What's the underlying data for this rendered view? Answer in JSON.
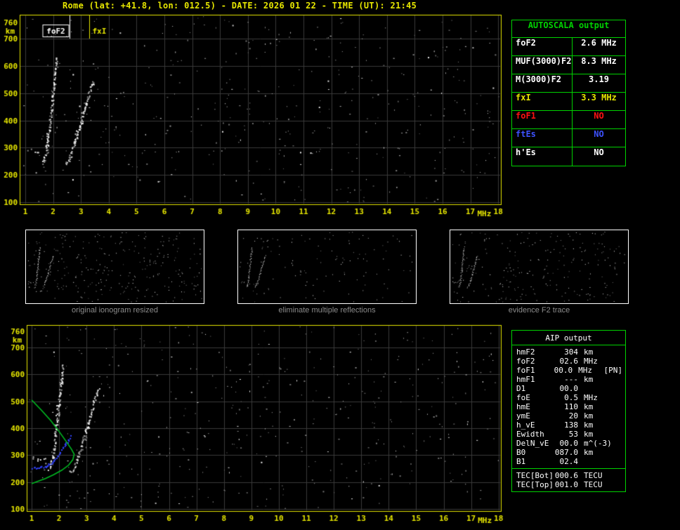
{
  "header": {
    "title": "Rome (lat: +41.8, lon: 012.5) - DATE: 2026 01 22 - TIME (UT): 21:45"
  },
  "colors": {
    "axis": "#e6e600",
    "grid": "#3a3a3a",
    "table_green": "#00d200",
    "caption_gray": "#8c8c8c",
    "white": "#ffffff",
    "yellow": "#e6e600",
    "red": "#ff1212",
    "blue": "#3d52ff",
    "profile_green": "#00bb22",
    "restored_blue": "#3344ff"
  },
  "autoscala": {
    "title": "AUTOSCALA output",
    "rows": [
      {
        "label": "foF2",
        "value": "2.6 MHz",
        "color": "#ffffff"
      },
      {
        "label": "MUF(3000)F2",
        "value": "8.3 MHz",
        "color": "#ffffff"
      },
      {
        "label": "M(3000)F2",
        "value": "3.19",
        "color": "#ffffff"
      },
      {
        "label": "fxI",
        "value": "3.3 MHz",
        "color": "#e6e600"
      },
      {
        "label": "foF1",
        "value": "NO",
        "color": "#ff1212"
      },
      {
        "label": "ftEs",
        "value": "NO",
        "color": "#3d52ff"
      },
      {
        "label": "h'Es",
        "value": "NO",
        "color": "#ffffff"
      }
    ]
  },
  "thumbnails": [
    {
      "caption": "original ionogram resized",
      "noise_count": 280,
      "seed": 3
    },
    {
      "caption": "eliminate multiple reflections",
      "noise_count": 120,
      "seed": 11
    },
    {
      "caption": "evidence F2 trace",
      "noise_count": 230,
      "seed": 19
    }
  ],
  "aip": {
    "title": "AIP output",
    "rows": [
      {
        "label": "hmF2",
        "value": "304",
        "unit": "km",
        "extra": ""
      },
      {
        "label": "foF2",
        "value": "02.6",
        "unit": "MHz",
        "extra": ""
      },
      {
        "label": "foF1",
        "value": "00.0",
        "unit": "MHz",
        "extra": "[PN]"
      },
      {
        "label": "hmF1",
        "value": "---",
        "unit": "km",
        "extra": ""
      },
      {
        "label": "D1",
        "value": "00.0",
        "unit": "",
        "extra": ""
      },
      {
        "label": "foE",
        "value": "0.5",
        "unit": "MHz",
        "extra": ""
      },
      {
        "label": "hmE",
        "value": "110",
        "unit": "km",
        "extra": ""
      },
      {
        "label": "ymE",
        "value": "20",
        "unit": "km",
        "extra": ""
      },
      {
        "label": "h_vE",
        "value": "138",
        "unit": "km",
        "extra": ""
      },
      {
        "label": "Ewidth",
        "value": "53",
        "unit": "km",
        "extra": ""
      },
      {
        "label": "DelN_vE",
        "value": "00.0",
        "unit": "m^(-3)",
        "extra": ""
      },
      {
        "label": "B0",
        "value": "087.0",
        "unit": "km",
        "extra": ""
      },
      {
        "label": "B1",
        "value": "02.4",
        "unit": "",
        "extra": ""
      }
    ],
    "tec_rows": [
      {
        "label": "TEC[Bot]",
        "value": "000.6",
        "unit": "TECU",
        "extra": ""
      },
      {
        "label": "TEC[Top]",
        "value": "001.0",
        "unit": "TECU",
        "extra": ""
      }
    ]
  },
  "chart_data": [
    {
      "type": "scatter",
      "title": "autoscaled ionogram",
      "xlabel": "MHz",
      "ylabel": "km",
      "xlim": [
        0.8,
        18.1
      ],
      "ylim": [
        90,
        788
      ],
      "x_ticks": [
        1,
        2,
        3,
        4,
        5,
        6,
        7,
        8,
        9,
        10,
        11,
        12,
        13,
        14,
        15,
        16,
        17,
        18
      ],
      "y_ticks": [
        760,
        700,
        600,
        500,
        400,
        300,
        200,
        100
      ],
      "y_gridlines": [
        100,
        200,
        300,
        400,
        500,
        600,
        700
      ],
      "markers": [
        {
          "label": "foF2",
          "f": 2.6,
          "color": "#ffffff",
          "boxed": true
        },
        {
          "label": "fxI",
          "f": 3.3,
          "color": "#e6e600",
          "boxed": false
        }
      ],
      "traces": [
        {
          "name": "F2-shelf",
          "points": [
            [
              1.05,
              293
            ],
            [
              1.3,
              290
            ],
            [
              1.55,
              288
            ]
          ],
          "density": 0.3
        },
        {
          "name": "F2-o-trace",
          "points": [
            [
              1.62,
              245
            ],
            [
              1.7,
              268
            ],
            [
              1.79,
              315
            ],
            [
              1.88,
              395
            ],
            [
              1.97,
              480
            ],
            [
              2.05,
              560
            ],
            [
              2.12,
              635
            ]
          ],
          "density": 1
        },
        {
          "name": "F2-x-trace",
          "points": [
            [
              2.45,
              240
            ],
            [
              2.56,
              262
            ],
            [
              2.7,
              300
            ],
            [
              2.86,
              352
            ],
            [
              3.02,
              410
            ],
            [
              3.18,
              465
            ],
            [
              3.32,
              515
            ],
            [
              3.44,
              550
            ]
          ],
          "density": 1
        }
      ],
      "noise": {
        "seed": 7,
        "count": 430
      }
    },
    {
      "type": "scatter",
      "title": "ionogram with restored F2 trace and electron density profile",
      "xlabel": "MHz",
      "ylabel": "km",
      "xlim": [
        0.8,
        18.1
      ],
      "ylim": [
        90,
        788
      ],
      "x_ticks": [
        1,
        2,
        3,
        4,
        5,
        6,
        7,
        8,
        9,
        10,
        11,
        12,
        13,
        14,
        15,
        16,
        17,
        18
      ],
      "y_ticks": [
        760,
        700,
        600,
        500,
        400,
        300,
        200,
        100
      ],
      "y_gridlines": [
        100,
        200,
        300,
        400,
        500,
        600,
        700
      ],
      "noise": {
        "seed": 29,
        "count": 430
      },
      "restored_trace": {
        "name": "scaled-F2-trace",
        "color": "#3344ff",
        "points": [
          [
            1.05,
            250
          ],
          [
            1.3,
            252
          ],
          [
            1.55,
            258
          ],
          [
            1.75,
            270
          ],
          [
            1.95,
            292
          ],
          [
            2.15,
            322
          ],
          [
            2.3,
            348
          ],
          [
            2.45,
            372
          ]
        ]
      },
      "profile": {
        "name": "electron-density-profile",
        "color": "#00bb22",
        "points": [
          [
            1.0,
            505
          ],
          [
            1.35,
            468
          ],
          [
            1.7,
            428
          ],
          [
            2.0,
            388
          ],
          [
            2.25,
            352
          ],
          [
            2.45,
            322
          ],
          [
            2.55,
            303
          ],
          [
            2.5,
            283
          ],
          [
            2.35,
            263
          ],
          [
            2.1,
            244
          ],
          [
            1.8,
            227
          ],
          [
            1.5,
            213
          ],
          [
            1.2,
            202
          ],
          [
            1.0,
            194
          ]
        ]
      }
    }
  ]
}
